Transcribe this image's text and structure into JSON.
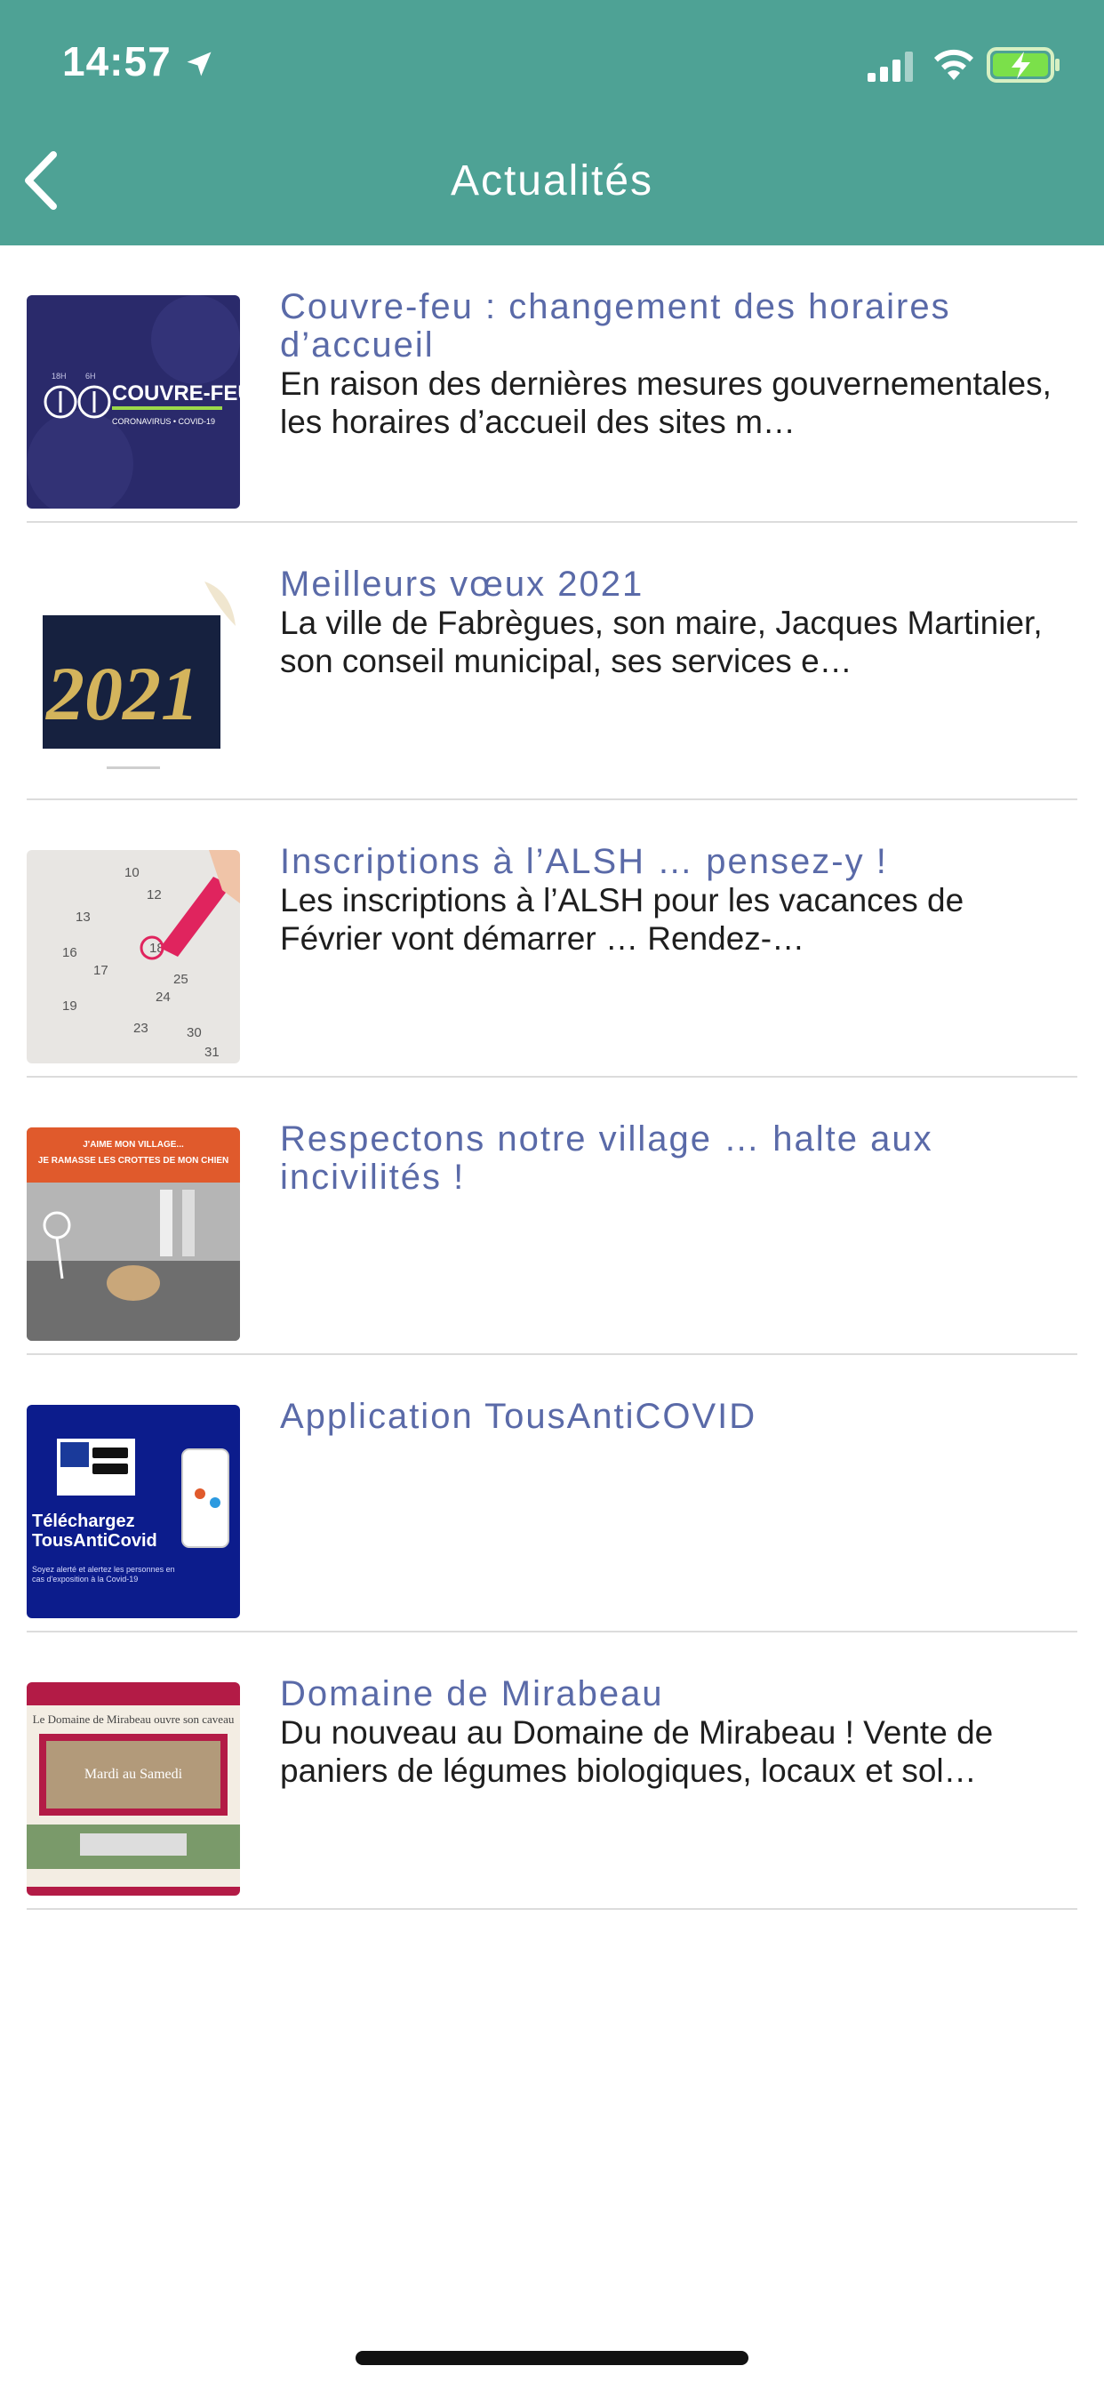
{
  "status": {
    "time": "14:57"
  },
  "header": {
    "title": "Actualités"
  },
  "colors": {
    "header": "#4ea295",
    "title": "#5a6aa8",
    "text": "#1e1e1e"
  },
  "items": [
    {
      "title": "Couvre-feu : changement des horaires d’accueil",
      "text": "En raison des dernières mesures gouvernementales, les horaires d’accueil des sites m…",
      "thumb_text": "COUVRE-FEU",
      "thumb_sub": "CORONAVIRUS • COVID-19",
      "thumb_hours_a": "18H",
      "thumb_hours_b": "6H"
    },
    {
      "title": "Meilleurs vœux 2021",
      "text": "La ville de Fabrègues, son maire, Jacques Martinier, son conseil municipal, ses services e…",
      "thumb_text": "2021"
    },
    {
      "title": "Inscriptions à l’ALSH … pensez-y !",
      "text": "Les inscriptions à l’ALSH pour les vacances de Février vont démarrer … Rendez-…",
      "thumb_days": [
        "10",
        "12",
        "13",
        "16",
        "17",
        "18",
        "19",
        "23",
        "24",
        "25",
        "30",
        "31"
      ]
    },
    {
      "title": "Respectons notre village … halte aux incivilités !",
      "text": "",
      "thumb_text": "J'AIME MON VILLAGE...",
      "thumb_sub": "JE RAMASSE LES CROTTES DE MON CHIEN"
    },
    {
      "title": "Application TousAntiCOVID",
      "text": "",
      "thumb_text": "Téléchargez TousAntiCovid",
      "thumb_sub": "Soyez alerté et alertez les personnes en cas d'exposition à la Covid-19"
    },
    {
      "title": "Domaine de Mirabeau",
      "text": "Du nouveau au Domaine de Mirabeau ! Vente de paniers de légumes biologiques, locaux et sol…",
      "thumb_text": "Le Domaine de Mirabeau ouvre son caveau",
      "thumb_sub": "Mardi au Samedi"
    }
  ]
}
